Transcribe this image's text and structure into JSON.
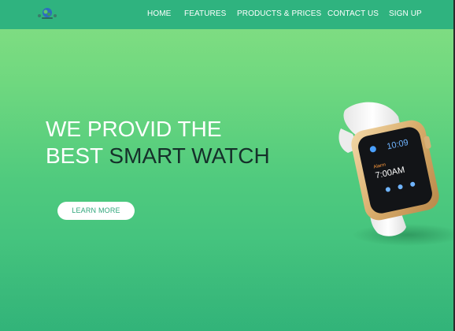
{
  "nav": {
    "logo": "logo-icon",
    "items": [
      {
        "label": "HOME"
      },
      {
        "label": "FEATURES"
      },
      {
        "label": "PRODUCTS & PRICES"
      },
      {
        "label": "CONTACT US"
      },
      {
        "label": "SIGN UP"
      }
    ]
  },
  "hero": {
    "title_line1": "WE PROVID THE",
    "title_line2_start": "BEST ",
    "title_line2_emphasis": "SMART WATCH",
    "cta_label": "LEARN MORE"
  },
  "watch": {
    "time": "10:09",
    "alarm_label": "Alarm",
    "alarm_time": "7:00AM"
  },
  "colors": {
    "navbar": "#2fb37f",
    "gradient_top": "#86df83",
    "gradient_bottom": "#34b97d",
    "title_emphasis": "#15302a",
    "button_text": "#2fa67b"
  }
}
